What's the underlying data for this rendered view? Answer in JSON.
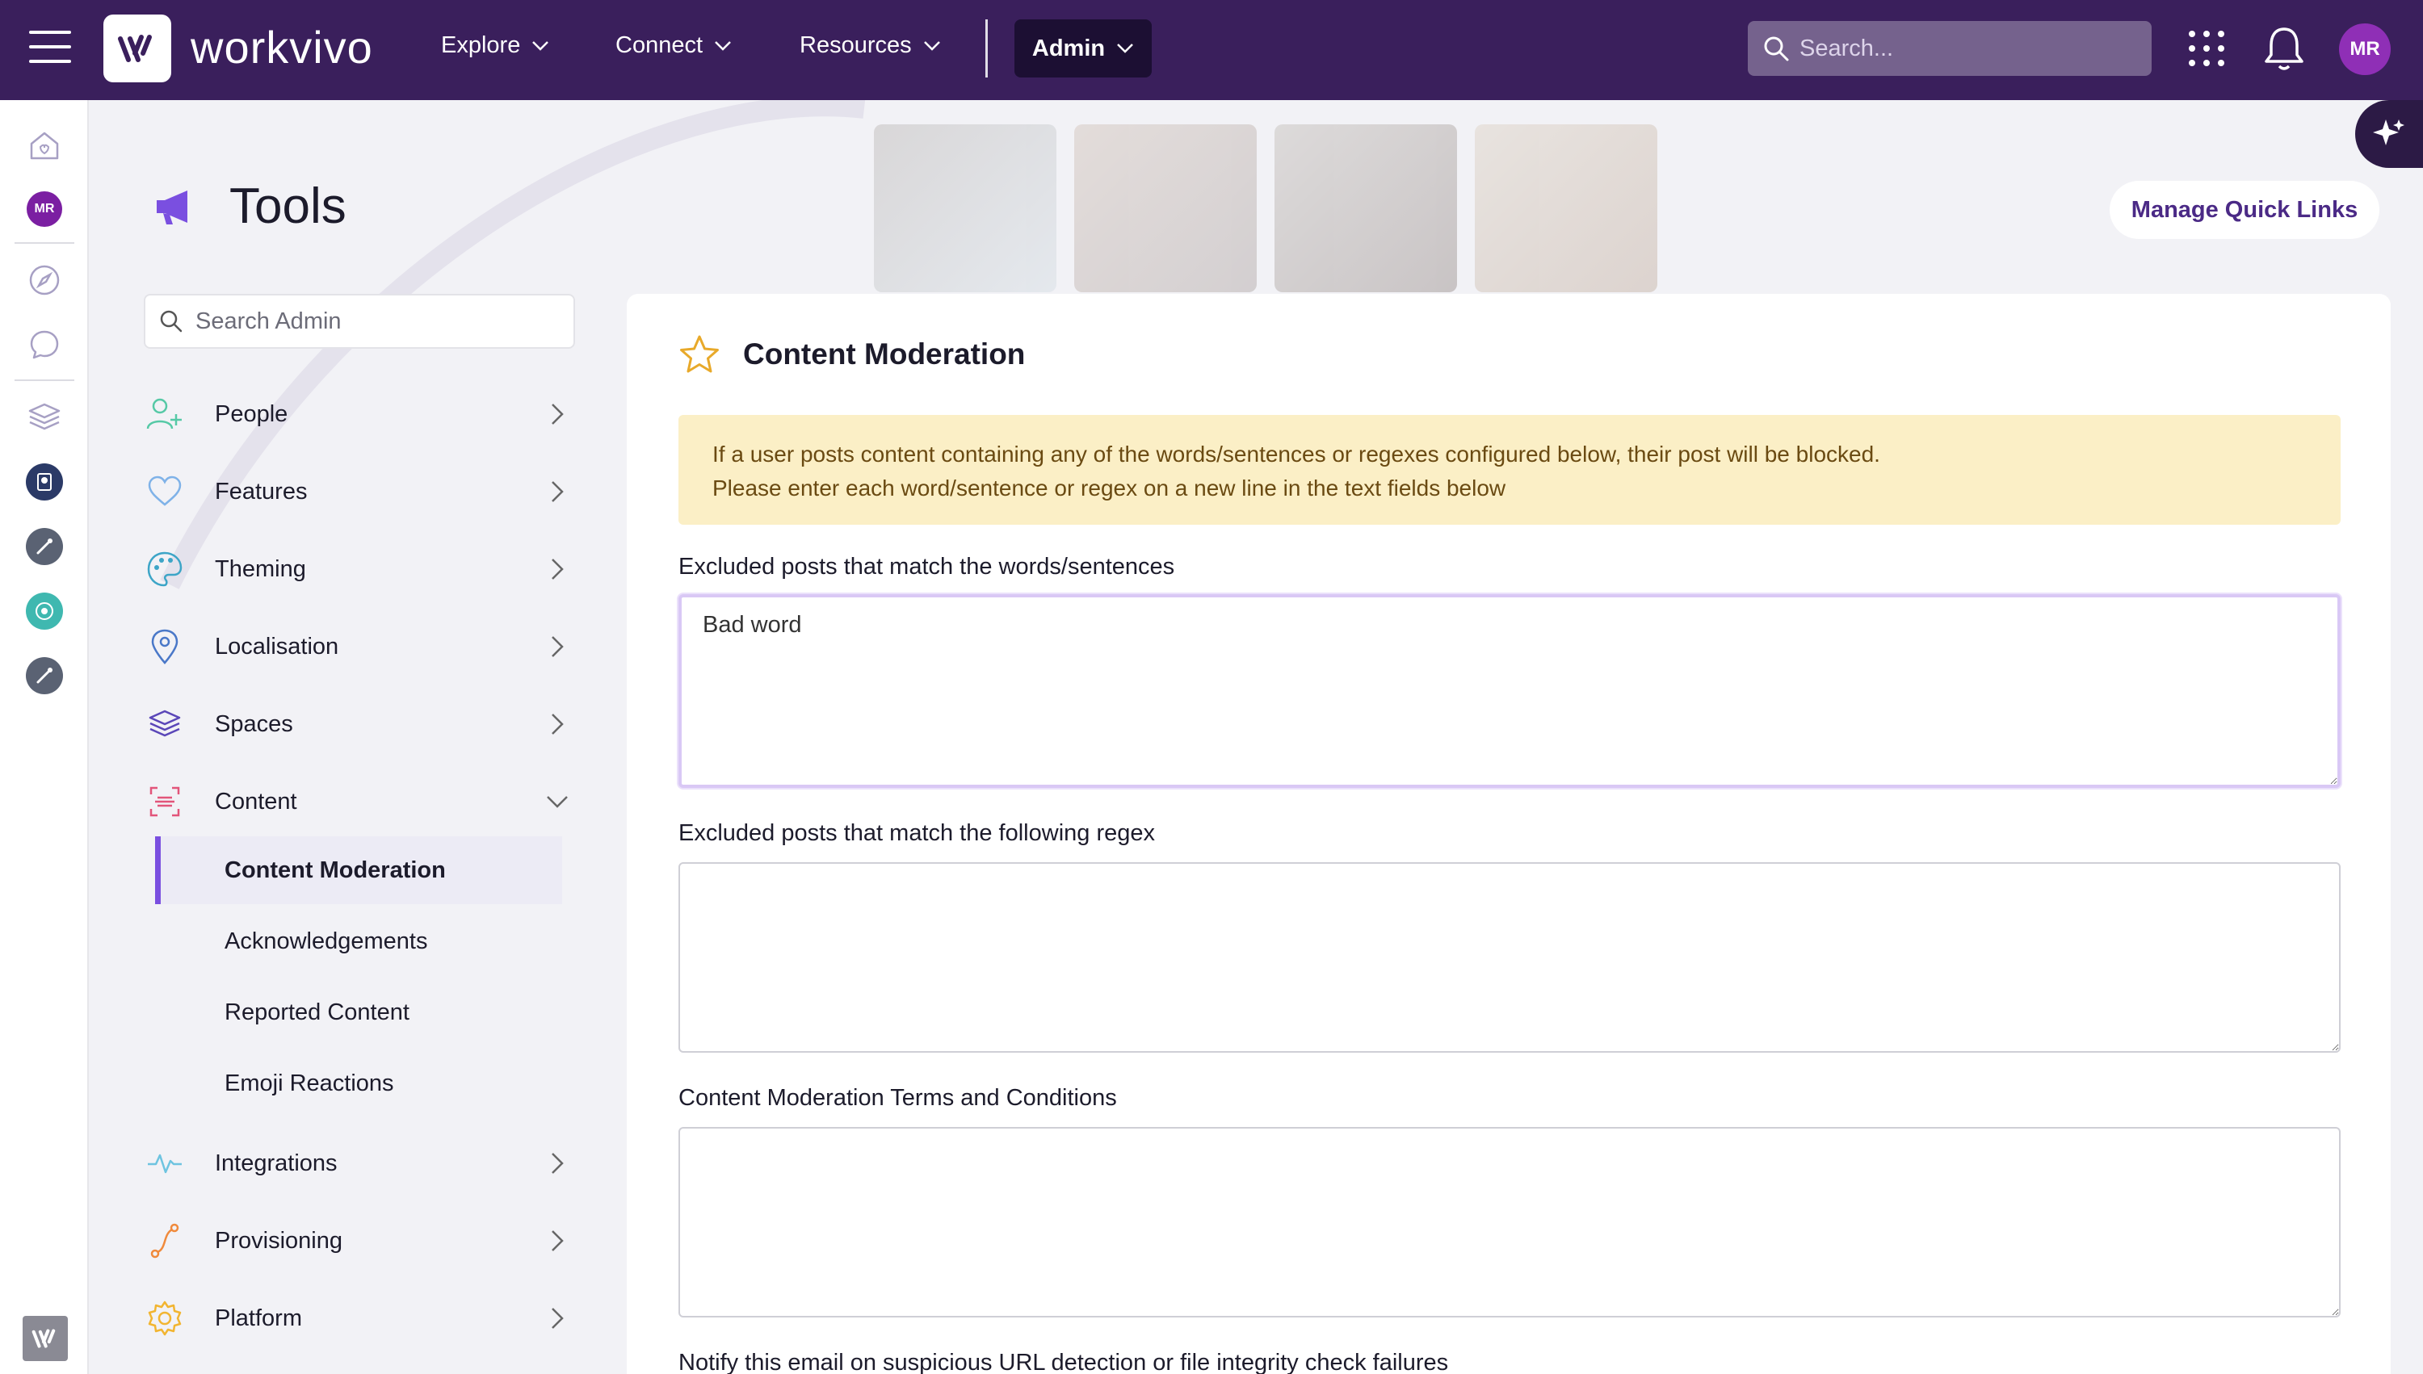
{
  "app": {
    "brand": "workvivo",
    "nav": [
      {
        "label": "Explore"
      },
      {
        "label": "Connect"
      },
      {
        "label": "Resources"
      }
    ],
    "admin_label": "Admin",
    "search_placeholder": "Search...",
    "user_initials": "MR"
  },
  "rail": {
    "user_initials": "MR"
  },
  "page": {
    "title": "Tools",
    "quick_links_label": "Manage Quick Links"
  },
  "sidebar": {
    "search_placeholder": "Search Admin",
    "items": [
      {
        "label": "People"
      },
      {
        "label": "Features"
      },
      {
        "label": "Theming"
      },
      {
        "label": "Localisation"
      },
      {
        "label": "Spaces"
      },
      {
        "label": "Content"
      },
      {
        "label": "Integrations"
      },
      {
        "label": "Provisioning"
      },
      {
        "label": "Platform"
      }
    ],
    "content_subitems": [
      {
        "label": "Content Moderation",
        "active": true
      },
      {
        "label": "Acknowledgements"
      },
      {
        "label": "Reported Content"
      },
      {
        "label": "Emoji Reactions"
      }
    ]
  },
  "panel": {
    "title": "Content Moderation",
    "notice_line1": "If a user posts content containing any of the words/sentences or regexes configured below, their post will be blocked.",
    "notice_line2": "Please enter each word/sentence or regex on a new line in the text fields below",
    "fields": [
      {
        "label": "Excluded posts that match the words/sentences",
        "value": "Bad word"
      },
      {
        "label": "Excluded posts that match the following regex",
        "value": ""
      },
      {
        "label": "Content Moderation Terms and Conditions",
        "value": ""
      },
      {
        "label": "Notify this email on suspicious URL detection or file integrity check failures"
      }
    ]
  },
  "colors": {
    "topbar": "#3a1f5c",
    "accent": "#7a4fe0",
    "notice_bg": "#fbefc6",
    "avatar": "#8f2fb6"
  }
}
